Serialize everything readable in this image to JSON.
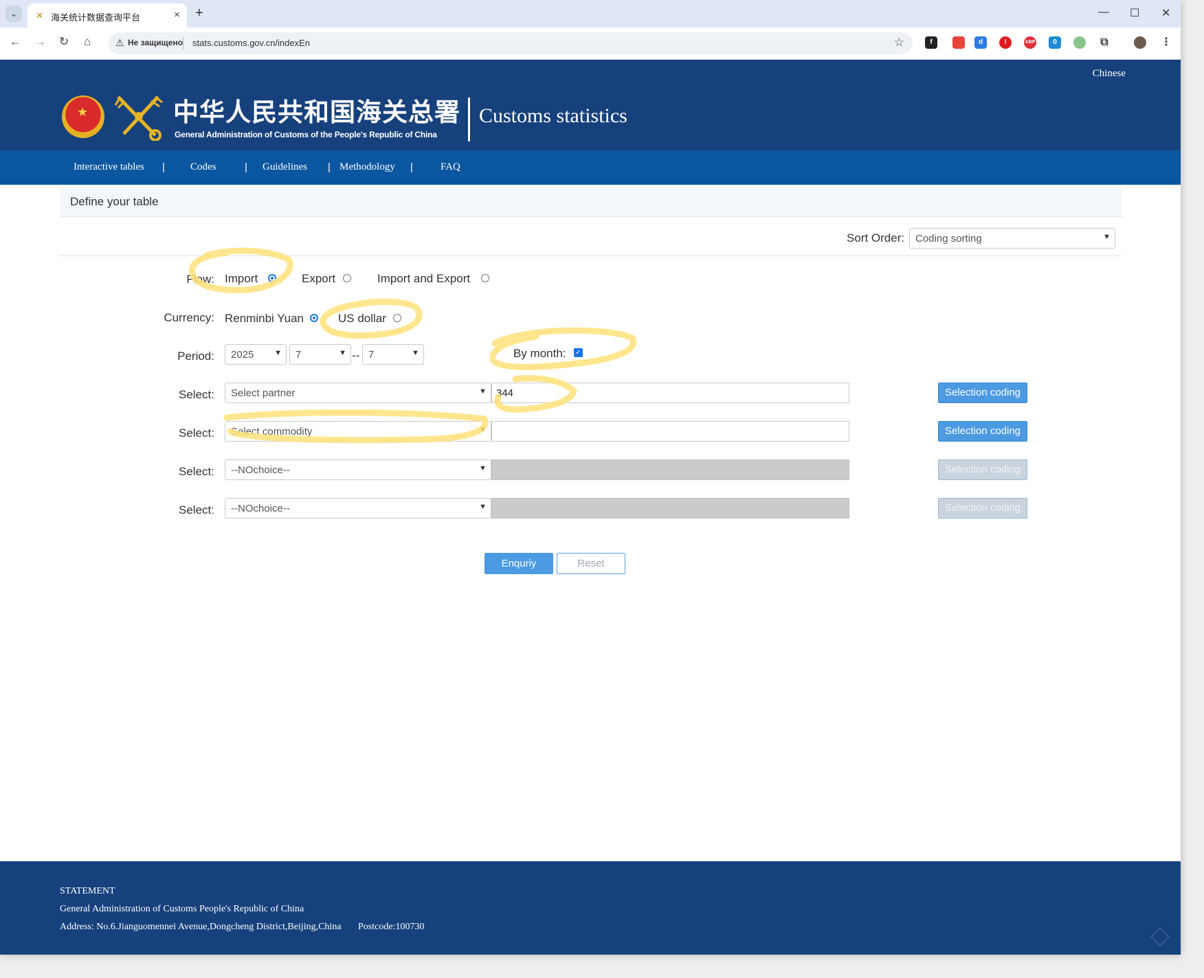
{
  "browser": {
    "tab_title": "海关统计数据查询平台",
    "security_label": "Не защищено",
    "url": "stats.customs.gov.cn/indexEn"
  },
  "header": {
    "language_link": "Chinese",
    "chinese_title": "中华人民共和国海关总署",
    "english_subtitle": "General Administration of Customs of the People's Republic of China",
    "site_title": "Customs statistics"
  },
  "nav": {
    "items": [
      {
        "label": "Interactive tables"
      },
      {
        "label": "Codes"
      },
      {
        "label": "Guidelines"
      },
      {
        "label": "Methodology"
      },
      {
        "label": "FAQ"
      }
    ],
    "separator": "|"
  },
  "main": {
    "section_title": "Define your table",
    "sort_order_label": "Sort Order:",
    "sort_order_value": "Coding sorting",
    "flow": {
      "label": "Flow:",
      "options": [
        {
          "label": "Import",
          "checked": true
        },
        {
          "label": "Export",
          "checked": false
        },
        {
          "label": "Import and Export",
          "checked": false
        }
      ]
    },
    "currency": {
      "label": "Currency:",
      "options": [
        {
          "label": "Renminbi Yuan",
          "checked": true
        },
        {
          "label": "US dollar",
          "checked": false
        }
      ]
    },
    "period": {
      "label": "Period:",
      "year": "2025",
      "month_from": "7",
      "dash": "--",
      "month_to": "7",
      "by_month_label": "By month:",
      "by_month_checked": true
    },
    "selects": [
      {
        "label": "Select:",
        "value": "Select partner",
        "input": "344",
        "button": "Selection coding",
        "enabled": true
      },
      {
        "label": "Select:",
        "value": "Select commodity",
        "input": "",
        "button": "Selection coding",
        "enabled": true
      },
      {
        "label": "Select:",
        "value": "--NOchoice--",
        "input": "",
        "button": "Selection coding",
        "enabled": false
      },
      {
        "label": "Select:",
        "value": "--NOchoice--",
        "input": "",
        "button": "Selection coding",
        "enabled": false
      }
    ],
    "enquiry_button": "Enquriy",
    "reset_button": "Reset"
  },
  "footer": {
    "statement": "STATEMENT",
    "org": "General Administration of Customs People's Republic of China",
    "address": "Address: No.6.Jianguomennei Avenue,Dongcheng District,Beijing,China",
    "postcode": "Postcode:100730"
  },
  "colors": {
    "header_bg": "#17417d",
    "nav_bg": "#0b56a0",
    "button_blue": "#4c9ae2",
    "highlight": "#ffe27a"
  }
}
